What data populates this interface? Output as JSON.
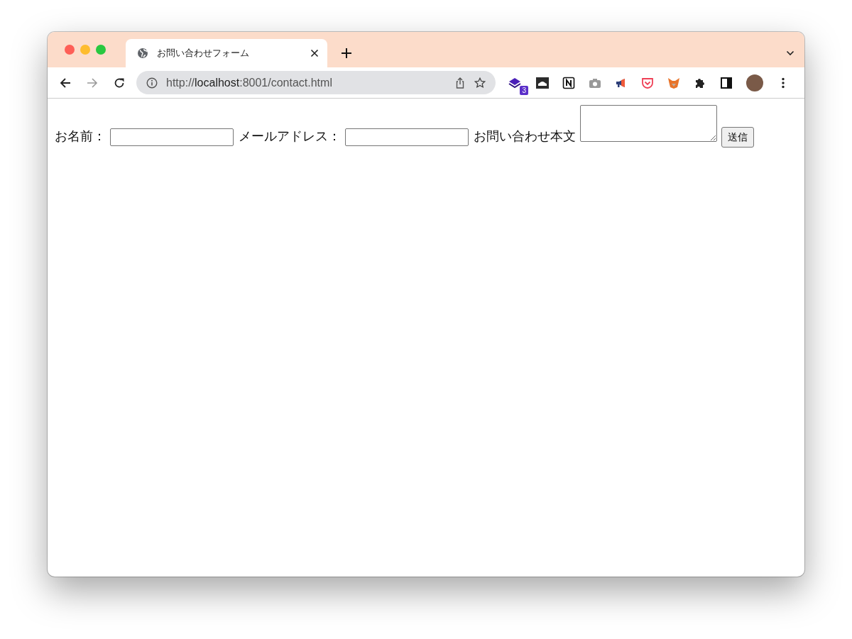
{
  "window": {
    "tab": {
      "title": "お問い合わせフォーム",
      "selected": true
    },
    "address_bar": {
      "scheme": "http://",
      "host": "localhost",
      "path": ":8001/contact.html"
    },
    "extension_badge": "3"
  },
  "form": {
    "fields": [
      {
        "kind": "label",
        "text": "お名前："
      },
      {
        "kind": "input"
      },
      {
        "kind": "label",
        "text": "メールアドレス："
      },
      {
        "kind": "input"
      },
      {
        "kind": "label",
        "text": "お問い合わせ本文"
      },
      {
        "kind": "textarea"
      },
      {
        "kind": "button",
        "text": "送信"
      }
    ]
  }
}
